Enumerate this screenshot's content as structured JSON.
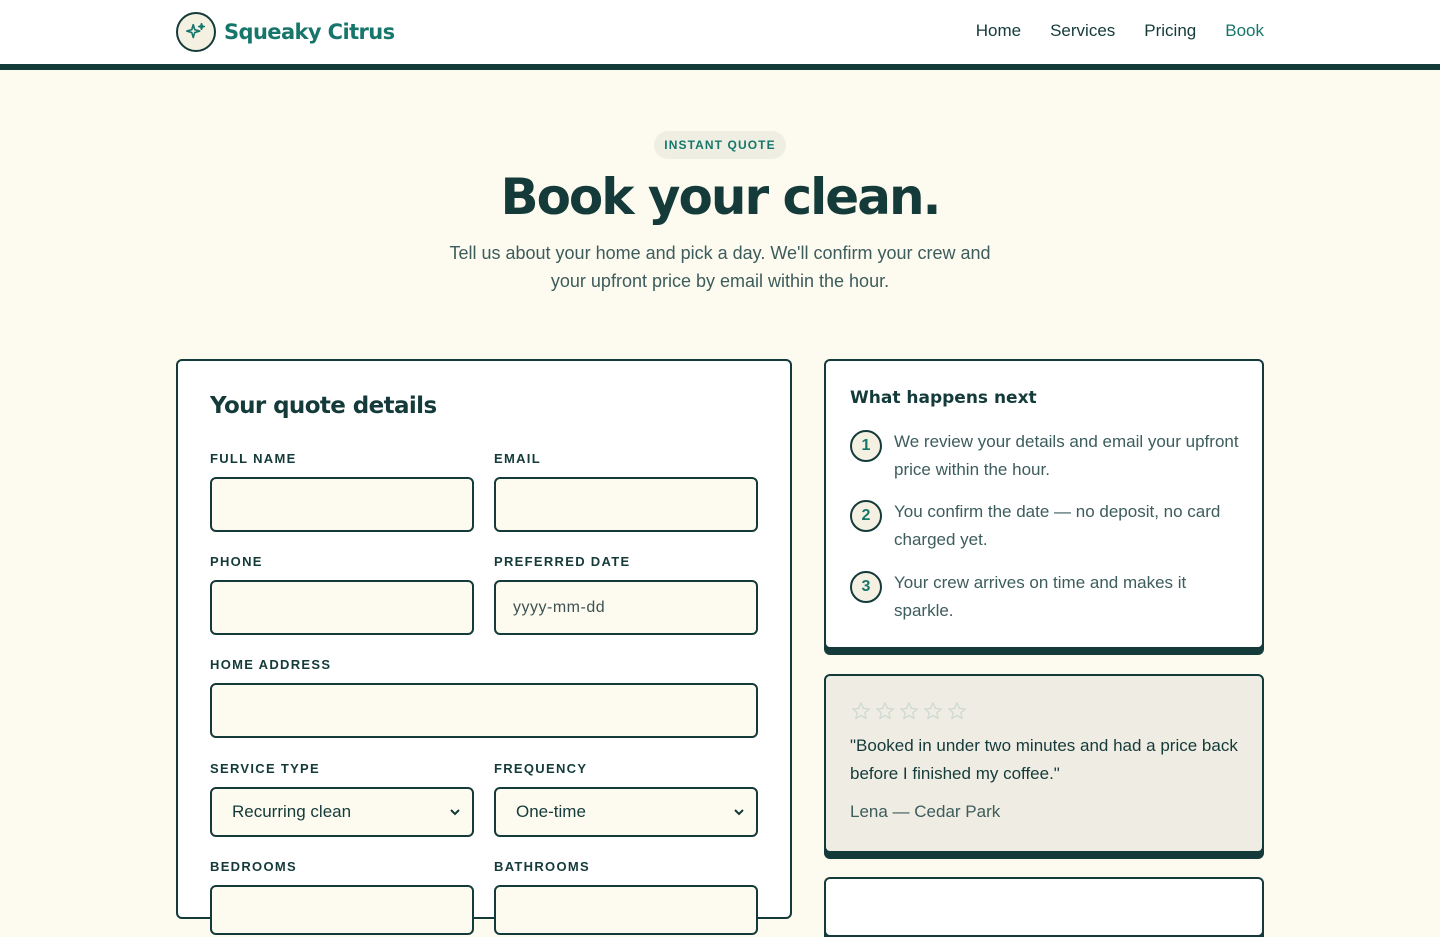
{
  "brand": {
    "name": "Squeaky Citrus",
    "icon": "sparkle-icon"
  },
  "nav": {
    "items": [
      "Home",
      "Services",
      "Pricing",
      "Book"
    ],
    "active": "Book"
  },
  "hero": {
    "eyebrow": "INSTANT QUOTE",
    "title": "Book your clean.",
    "subtitle": "Tell us about your home and pick a day. We'll confirm your crew and your upfront price by email within the hour."
  },
  "form": {
    "title": "Your quote details",
    "full_name": {
      "label": "FULL NAME",
      "value": ""
    },
    "email": {
      "label": "EMAIL",
      "value": ""
    },
    "phone": {
      "label": "PHONE",
      "value": ""
    },
    "preferred_date": {
      "label": "PREFERRED DATE",
      "placeholder": "yyyy-mm-dd",
      "value": ""
    },
    "home_address": {
      "label": "HOME ADDRESS",
      "value": ""
    },
    "service_type": {
      "label": "SERVICE TYPE",
      "selected": "Recurring clean"
    },
    "frequency": {
      "label": "FREQUENCY",
      "selected": "One-time"
    },
    "bedrooms": {
      "label": "BEDROOMS"
    },
    "bathrooms": {
      "label": "BATHROOMS"
    }
  },
  "next_steps": {
    "title": "What happens next",
    "steps": [
      {
        "number": "1",
        "text": "We review your details and email your upfront price within the hour."
      },
      {
        "number": "2",
        "text": "You confirm the date — no deposit, no card charged yet."
      },
      {
        "number": "3",
        "text": "Your crew arrives on time and makes it sparkle."
      }
    ]
  },
  "testimonial": {
    "rating": {
      "value": 0,
      "max": 5
    },
    "quote": "\"Booked in under two minutes and had a price back before I finished my coffee.\"",
    "author": "Lena — Cedar Park"
  },
  "colors": {
    "accent": "#17766b",
    "ink": "#143a3a",
    "background": "#fdfbef",
    "muted_text": "#3d5c5c",
    "card_muted": "#efede3"
  }
}
